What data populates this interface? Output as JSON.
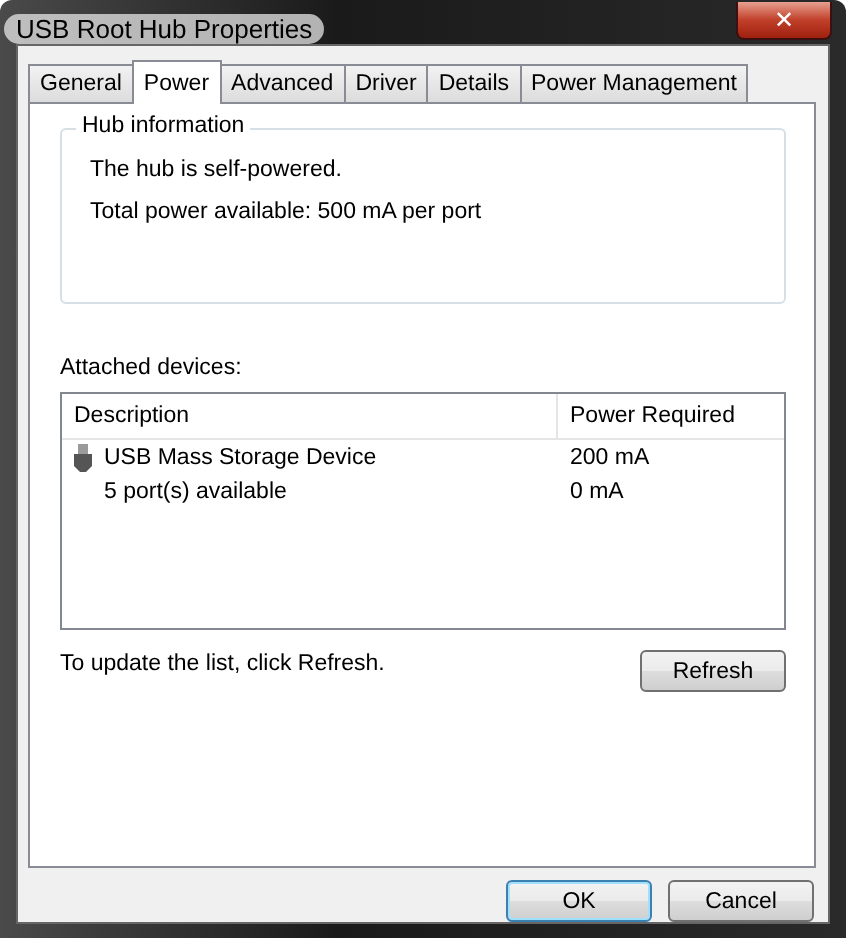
{
  "window": {
    "title": "USB Root Hub Properties",
    "close": "✕"
  },
  "tabs": [
    {
      "label": "General",
      "selected": false
    },
    {
      "label": "Power",
      "selected": true
    },
    {
      "label": "Advanced",
      "selected": false
    },
    {
      "label": "Driver",
      "selected": false
    },
    {
      "label": "Details",
      "selected": false
    },
    {
      "label": "Power Management",
      "selected": false
    }
  ],
  "hub_information": {
    "title": "Hub information",
    "lines": [
      "The hub is self-powered.",
      "Total power available:  500 mA per port"
    ]
  },
  "attached_devices": {
    "label": "Attached devices:",
    "columns": [
      "Description",
      "Power Required"
    ],
    "rows": [
      {
        "kind": "device",
        "description": "USB Mass Storage Device",
        "power": "200 mA"
      },
      {
        "kind": "ports",
        "description": "5 port(s) available",
        "power": "0 mA"
      }
    ]
  },
  "hint": "To update the list, click Refresh.",
  "refresh_button": "Refresh",
  "buttons": [
    {
      "label": "OK",
      "default": true
    },
    {
      "label": "Cancel",
      "default": false
    }
  ]
}
